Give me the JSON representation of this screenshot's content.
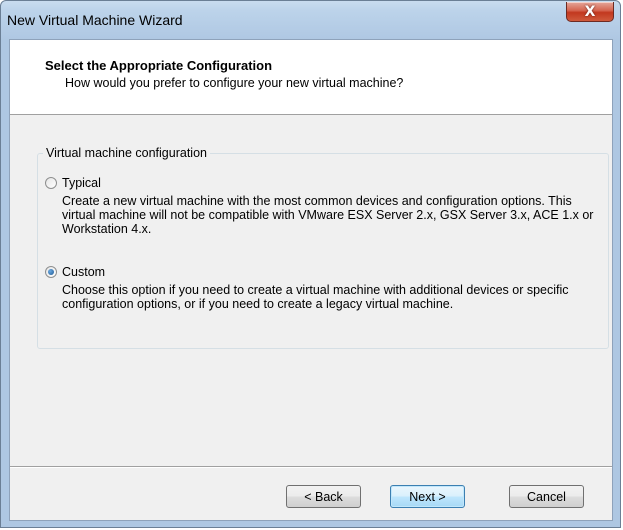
{
  "window": {
    "title": "New Virtual Machine Wizard",
    "close_glyph": "X"
  },
  "header": {
    "title": "Select the Appropriate Configuration",
    "subtitle": "How would you prefer to configure your new virtual machine?"
  },
  "config_group": {
    "legend": "Virtual machine configuration",
    "options": [
      {
        "label": "Typical",
        "selected": false,
        "description": "Create a new virtual machine with the most common devices and configuration options. This virtual machine will not be compatible with VMware ESX Server 2.x, GSX Server 3.x, ACE 1.x or Workstation 4.x."
      },
      {
        "label": "Custom",
        "selected": true,
        "description": "Choose this option if you need to create a virtual machine with additional devices or specific configuration options, or if you need to create a legacy virtual machine."
      }
    ]
  },
  "buttons": {
    "back": "< Back",
    "next": "Next >",
    "cancel": "Cancel"
  },
  "colors": {
    "title_bar": "#b9d1ea",
    "close_button": "#c7432a",
    "dialog_face": "#f0f0f0"
  }
}
